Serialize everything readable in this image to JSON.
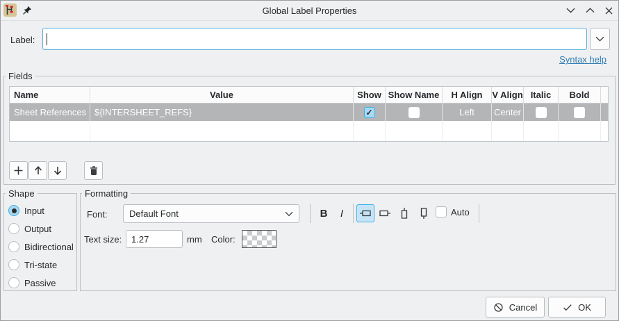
{
  "window": {
    "title": "Global Label Properties",
    "icons": {
      "app": "kicad-schematic-icon",
      "pin": "pin-icon"
    },
    "controls": {
      "shade": "chevron-down",
      "unshade": "chevron-up",
      "close": "close-x"
    }
  },
  "label_section": {
    "label": "Label:",
    "value": "",
    "syntax_help_link": "Syntax help"
  },
  "fields_section": {
    "group_label": "Fields",
    "table": {
      "headers": [
        "Name",
        "Value",
        "Show",
        "Show Name",
        "H Align",
        "V Align",
        "Italic",
        "Bold"
      ],
      "rows": [
        {
          "name": "Sheet References",
          "value": "${INTERSHEET_REFS}",
          "show": true,
          "show_name": false,
          "h_align": "Left",
          "v_align": "Center",
          "italic": false,
          "bold": false
        }
      ]
    },
    "toolbar_icons": [
      "plus-icon",
      "arrow-up-icon",
      "arrow-down-icon",
      "trash-icon"
    ]
  },
  "shape_section": {
    "group_label": "Shape",
    "options": [
      "Input",
      "Output",
      "Bidirectional",
      "Tri-state",
      "Passive"
    ],
    "selected": "Input"
  },
  "formatting_section": {
    "group_label": "Formatting",
    "font_label": "Font:",
    "font_value": "Default Font",
    "bold_button": "B",
    "italic_button": "I",
    "orientation_icons": [
      "label-orient-right-icon",
      "label-orient-left-icon",
      "label-orient-up-icon",
      "label-orient-down-icon"
    ],
    "orientation_selected": 0,
    "auto_checkbox_label": "Auto",
    "auto_checked": false,
    "text_size_label": "Text size:",
    "text_size_value": "1.27",
    "text_size_unit": "mm",
    "color_label": "Color:",
    "color_value": "transparent-checkerboard"
  },
  "dialog_buttons": {
    "cancel": "Cancel",
    "ok": "OK"
  },
  "colors": {
    "window_bg": "#eff0f1",
    "accent": "#3daee9",
    "selected_row_bg": "#b3b5b7",
    "link": "#2e7db3"
  }
}
